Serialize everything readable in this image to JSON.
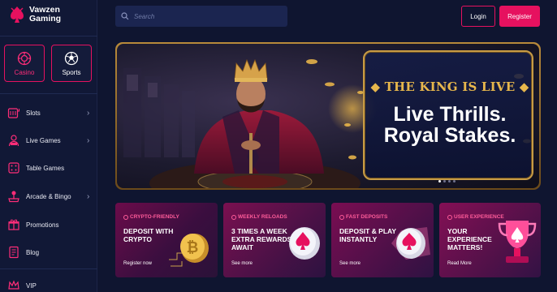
{
  "brand": {
    "name_line1": "Vawzen",
    "name_line2": "Gaming"
  },
  "search": {
    "placeholder": "Search"
  },
  "auth": {
    "login_label": "Login",
    "register_label": "Register"
  },
  "categories": [
    {
      "label": "Casino",
      "icon": "casino-chip-icon",
      "active": true
    },
    {
      "label": "Sports",
      "icon": "soccer-ball-icon",
      "active": false
    }
  ],
  "sidebar": {
    "items": [
      {
        "label": "Slots",
        "icon": "slot-machine-icon",
        "has_chevron": true
      },
      {
        "label": "Live Games",
        "icon": "live-dealer-icon",
        "has_chevron": true
      },
      {
        "label": "Table Games",
        "icon": "dice-icon",
        "has_chevron": false
      },
      {
        "label": "Arcade & Bingo",
        "icon": "joystick-icon",
        "has_chevron": true
      },
      {
        "label": "Promotions",
        "icon": "gift-icon",
        "has_chevron": false
      },
      {
        "label": "Blog",
        "icon": "document-icon",
        "has_chevron": false
      },
      {
        "label": "VIP",
        "icon": "crown-icon",
        "has_chevron": false
      }
    ]
  },
  "hero": {
    "tagline": "THE KING IS LIVE",
    "headline_line1": "Live Thrills.",
    "headline_line2": "Royal Stakes.",
    "slides": 4,
    "active_slide": 1
  },
  "promos": [
    {
      "tag": "CRYPTO-FRIENDLY",
      "title": "DEPOSIT WITH CRYPTO",
      "link": "Register now",
      "icon": "bitcoin-coin-icon",
      "tag_color": "#ff5c9a"
    },
    {
      "tag": "WEEKLY RELOADS",
      "title": "3 TIMES A WEEK EXTRA REWARDS AWAIT",
      "link": "See more",
      "icon": "spade-coin-icon",
      "tag_color": "#ff5c9a"
    },
    {
      "tag": "FAST DEPOSITS",
      "title": "DEPOSIT & PLAY INSTANTLY",
      "link": "See more",
      "icon": "spade-coin-icon",
      "tag_color": "#ff5c9a"
    },
    {
      "tag": "USER EXPERIENCE",
      "title": "YOUR EXPERIENCE MATTERS!",
      "link": "Read More",
      "icon": "trophy-icon",
      "tag_color": "#ff5c9a"
    }
  ],
  "colors": {
    "accent": "#e6115f",
    "background": "#0f1530",
    "sidebar": "#111836",
    "gold": "#e7b74c"
  }
}
